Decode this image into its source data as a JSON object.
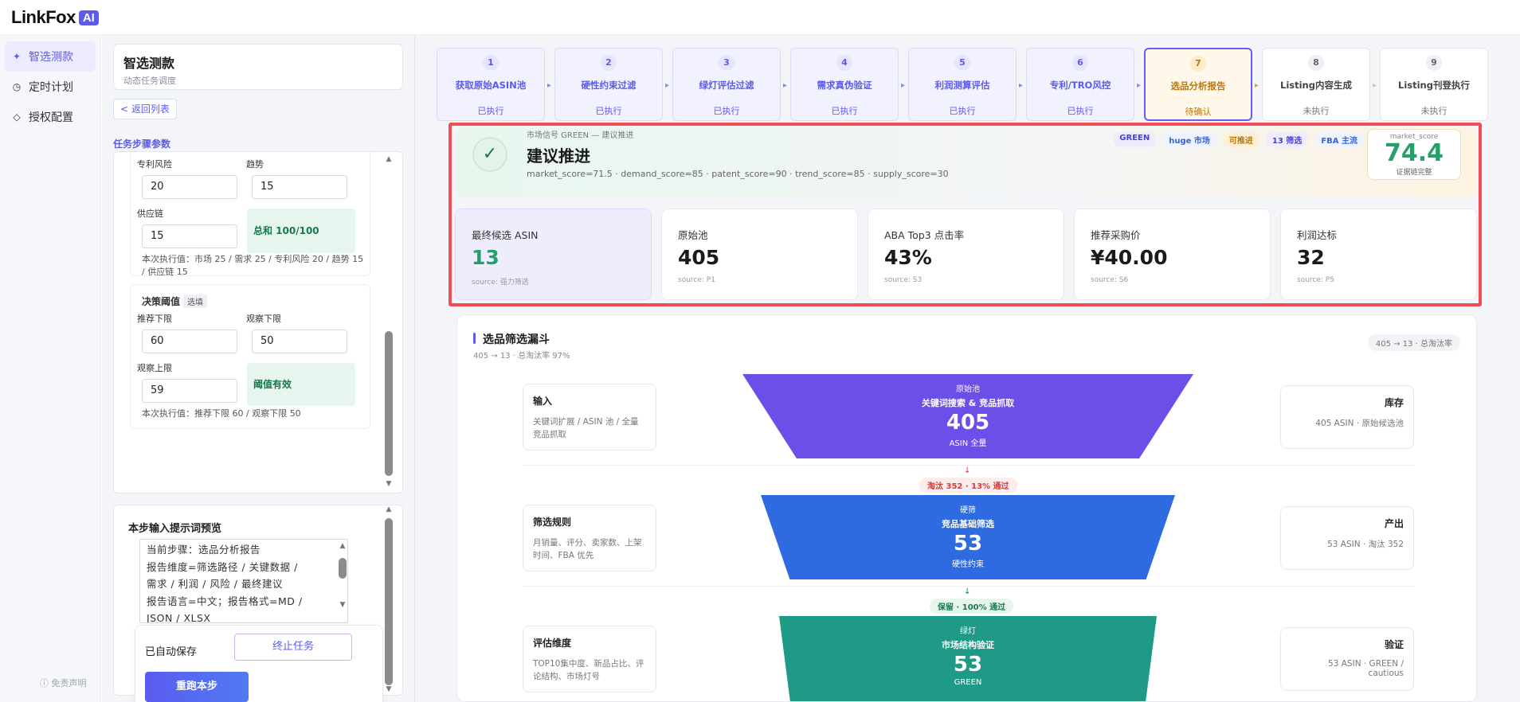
{
  "app": {
    "logo_text": "LinkFox",
    "logo_badge": "AI"
  },
  "sidebar": {
    "items": [
      {
        "label": "智选测款",
        "icon": "sparkle-icon",
        "active": true
      },
      {
        "label": "定时计划",
        "icon": "clock-icon",
        "active": false
      },
      {
        "label": "授权配置",
        "icon": "diamond-icon",
        "active": false
      }
    ],
    "disclaimer": "ⓘ 免责声明"
  },
  "config": {
    "title": "智选测款",
    "subtitle": "动态任务调度",
    "back_label": "< 返回列表",
    "section_label": "任务步骤参数",
    "weights": {
      "patent_label": "专利风险",
      "patent_value": "20",
      "trend_label": "趋势",
      "trend_value": "15",
      "supply_label": "供应链",
      "supply_value": "15",
      "sum_text": "总和 100/100",
      "note": "本次执行值：市场 25 / 需求 25 / 专利风险 20 / 趋势 15 / 供应链 15"
    },
    "thresholds": {
      "title": "决策阈值",
      "chip": "选填",
      "rec_label": "推荐下限",
      "rec_value": "60",
      "obs_low_label": "观察下限",
      "obs_low_value": "50",
      "obs_high_label": "观察上限",
      "obs_high_value": "59",
      "valid_text": "阈值有效",
      "note": "本次执行值：推荐下限 60 / 观察下限 50"
    },
    "prompt": {
      "title": "本步输入提示词预览",
      "lines": [
        "当前步骤：选品分析报告",
        "报告维度=筛选路径 / 关键数据 /",
        "需求 / 利润 / 风险 / 最终建议",
        "报告语言=中文；报告格式=MD /",
        "JSON / XLSX"
      ]
    },
    "autosave": "已自动保存",
    "stop_label": "终止任务",
    "rerun_label": "重跑本步"
  },
  "steps": [
    {
      "num": "1",
      "name": "获取原始ASIN池",
      "status": "已执行",
      "state": "done"
    },
    {
      "num": "2",
      "name": "硬性约束过滤",
      "status": "已执行",
      "state": "done"
    },
    {
      "num": "3",
      "name": "绿灯评估过滤",
      "status": "已执行",
      "state": "done"
    },
    {
      "num": "4",
      "name": "需求真伪验证",
      "status": "已执行",
      "state": "done"
    },
    {
      "num": "5",
      "name": "利润测算评估",
      "status": "已执行",
      "state": "done"
    },
    {
      "num": "6",
      "name": "专利/TRO风控",
      "status": "已执行",
      "state": "done"
    },
    {
      "num": "7",
      "name": "选品分析报告",
      "status": "待确认",
      "state": "current"
    },
    {
      "num": "8",
      "name": "Listing内容生成",
      "status": "未执行",
      "state": "pending"
    },
    {
      "num": "9",
      "name": "Listing刊登执行",
      "status": "未执行",
      "state": "pending"
    }
  ],
  "signal": {
    "top": "市场信号 GREEN — 建议推进",
    "title": "建议推进",
    "scores": "market_score=71.5 · demand_score=85 · patent_score=90 · trend_score=85 · supply_score=30",
    "chips": [
      {
        "label": "GREEN",
        "bg": "#eeedfe",
        "fg": "#4a3fd6"
      },
      {
        "label": "huge 市场",
        "bg": "#eef3ff",
        "fg": "#3563d8"
      },
      {
        "label": "可推进",
        "bg": "#fdf0d6",
        "fg": "#b9770e"
      },
      {
        "label": "13 筛选",
        "bg": "#eeedfe",
        "fg": "#4a3fd6"
      },
      {
        "label": "FBA 主流",
        "bg": "#eef3ff",
        "fg": "#3563d8"
      }
    ],
    "score_label": "market_score",
    "score_value": "74.4",
    "score_sub": "证据链完整"
  },
  "metrics": [
    {
      "label": "最终候选 ASIN",
      "value": "13",
      "source": "source: 强力筛选"
    },
    {
      "label": "原始池",
      "value": "405",
      "source": "source: P1"
    },
    {
      "label": "ABA Top3 点击率",
      "value": "43%",
      "source": "source: S3"
    },
    {
      "label": "推荐采购价",
      "value": "¥40.00",
      "source": "source: S6"
    },
    {
      "label": "利润达标",
      "value": "32",
      "source": "source: P5"
    }
  ],
  "funnel": {
    "title": "选品筛选漏斗",
    "subtitle": "405 → 13 · 总淘汰率 97%",
    "pill": "405 → 13 · 总淘汰率",
    "stages": [
      {
        "left_title": "输入",
        "left_desc": "关键词扩展 / ASIN 池 / 全量竞品抓取",
        "kicker": "原始池",
        "name": "关键词搜索 & 竞品抓取",
        "value": "405",
        "unit": "ASIN 全量",
        "right_title": "库存",
        "right_desc": "405 ASIN · 原始候选池",
        "color": "#6b4fe8"
      },
      {
        "left_title": "筛选规则",
        "left_desc": "月销量、评分、卖家数、上架时间、FBA 优先",
        "kicker": "硬筛",
        "name": "竞品基础筛选",
        "value": "53",
        "unit": "硬性约束",
        "right_title": "产出",
        "right_desc": "53 ASIN · 淘汰 352",
        "color": "#2f6be0"
      },
      {
        "left_title": "评估维度",
        "left_desc": "TOP10集中度、新品占比、评论结构、市场灯号",
        "kicker": "绿灯",
        "name": "市场结构验证",
        "value": "53",
        "unit": "GREEN",
        "right_title": "验证",
        "right_desc": "53 ASIN · GREEN / cautious",
        "color": "#1f9a86"
      }
    ],
    "transitions": [
      {
        "text": "淘汰 352 · 13% 通过",
        "bg": "#fdecec",
        "fg": "#d23c3c"
      },
      {
        "text": "保留 · 100% 通过",
        "bg": "#e6f6ee",
        "fg": "#18794e"
      }
    ]
  }
}
